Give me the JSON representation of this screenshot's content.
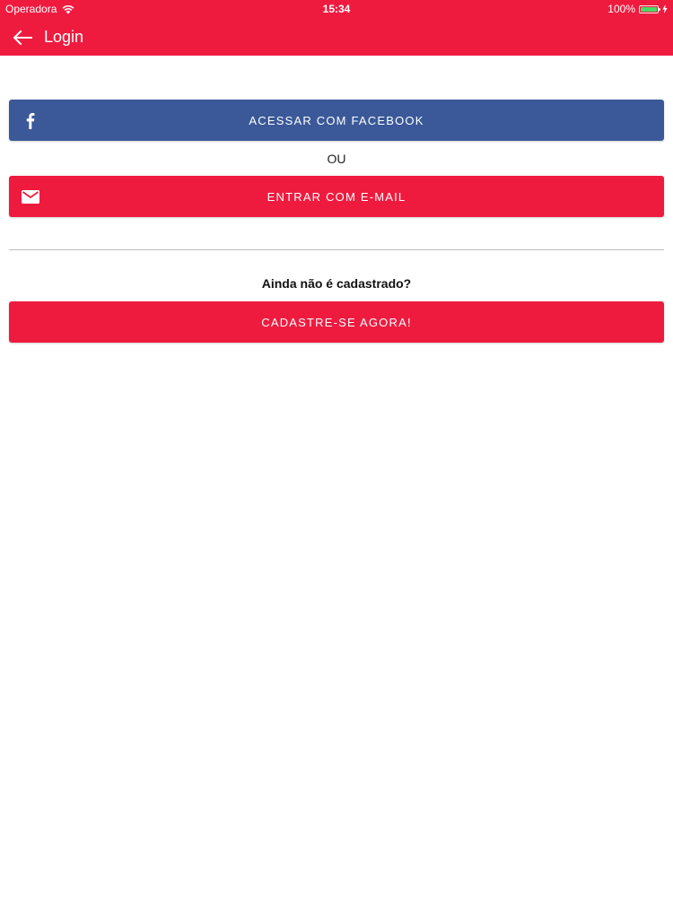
{
  "status_bar": {
    "carrier": "Operadora",
    "time": "15:34",
    "battery": "100%",
    "wifi_icon": "wifi-icon",
    "battery_icon": "battery-icon",
    "battery_level": 1.0
  },
  "nav": {
    "title": "Login",
    "back_icon": "arrow-left-icon"
  },
  "buttons": {
    "facebook": {
      "label": "ACESSAR COM FACEBOOK",
      "icon": "facebook-icon",
      "color": "#3b5998"
    },
    "or": "OU",
    "email": {
      "label": "ENTRAR COM E-MAIL",
      "icon": "envelope-icon",
      "color": "#ee1b3f"
    }
  },
  "register": {
    "prompt": "Ainda não é cadastrado?",
    "label": "CADASTRE-SE AGORA!"
  },
  "colors": {
    "primary": "#ee1b3f",
    "facebook": "#3b5998"
  }
}
